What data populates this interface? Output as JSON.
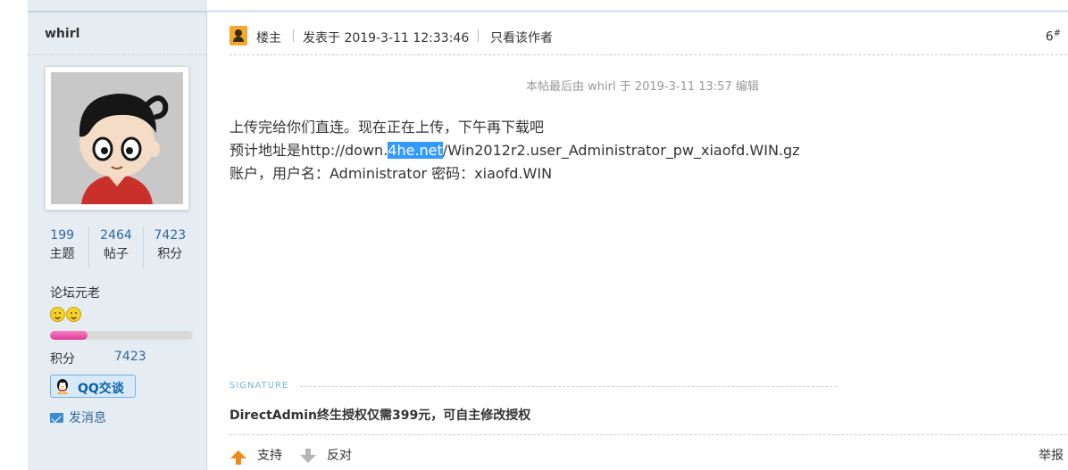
{
  "user": {
    "name": "whirl",
    "stats": [
      {
        "value": "199",
        "label": "主题"
      },
      {
        "value": "2464",
        "label": "帖子"
      },
      {
        "value": "7423",
        "label": "积分"
      }
    ],
    "rank": "论坛元老",
    "rank_icons": [
      "smile-icon",
      "smile-icon"
    ],
    "progress_fraction": 0.26,
    "credit_label": "积分",
    "credit_value": "7423",
    "qq_label": "QQ交谈",
    "message_label": "发消息"
  },
  "post": {
    "author_tag": "楼主",
    "posted_at": "发表于 2019-3-11 12:33:46",
    "only_author": "只看该作者",
    "floor": "6",
    "floor_mark": "#",
    "edit_note": "本帖最后由 whirl 于 2019-3-11 13:57 编辑",
    "body": {
      "line1": "上传完给你们直连。现在正在上传，下午再下载吧",
      "line2_prefix": "预计地址是http://down.",
      "line2_highlight": "4he.net",
      "line2_suffix": "/Win2012r2.user_Administrator_pw_xiaofd.WIN.gz",
      "line3": "账户，用户名：Administrator 密码：xiaofd.WIN"
    },
    "signature_label": "SIGNATURE",
    "signature_text": "DirectAdmin终生授权仅需399元，可自主修改授权",
    "support_label": "支持",
    "oppose_label": "反对",
    "report_label": "举报"
  },
  "colors": {
    "sidebar_bg": "#e5edf2",
    "link": "#336699",
    "progress": "#e03c99",
    "selection": "#3399ff"
  }
}
